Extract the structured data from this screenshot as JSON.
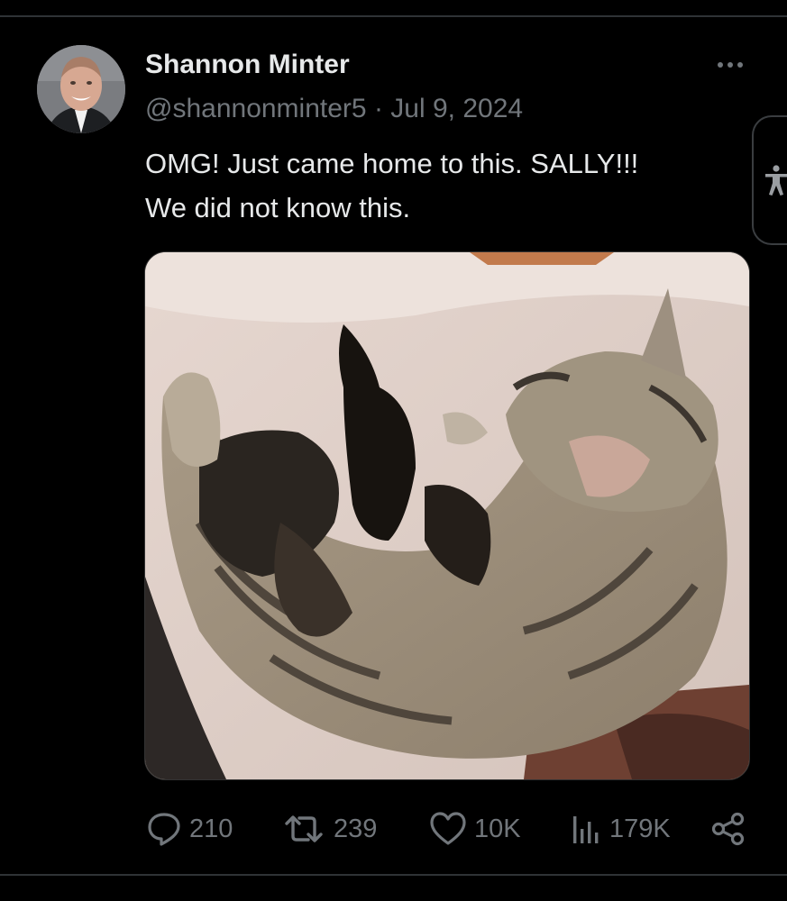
{
  "post": {
    "author_name": "Shannon Minter",
    "author_handle": "@shannonminter5",
    "separator": "·",
    "date": "Jul 9, 2024",
    "text_lines": [
      "OMG! Just came home to this. SALLY!!!",
      "We did not know this."
    ]
  },
  "stats": {
    "replies": "210",
    "reposts": "239",
    "likes": "10K",
    "views": "179K"
  },
  "icons": {
    "more": "more-horizontal-icon",
    "reply": "reply-icon",
    "repost": "repost-icon",
    "like": "heart-icon",
    "views": "views-icon",
    "share": "share-icon",
    "accessibility": "accessibility-icon"
  },
  "colors": {
    "background": "#000000",
    "text": "#e7e9ea",
    "muted": "#71767b",
    "divider": "#2f3336"
  }
}
